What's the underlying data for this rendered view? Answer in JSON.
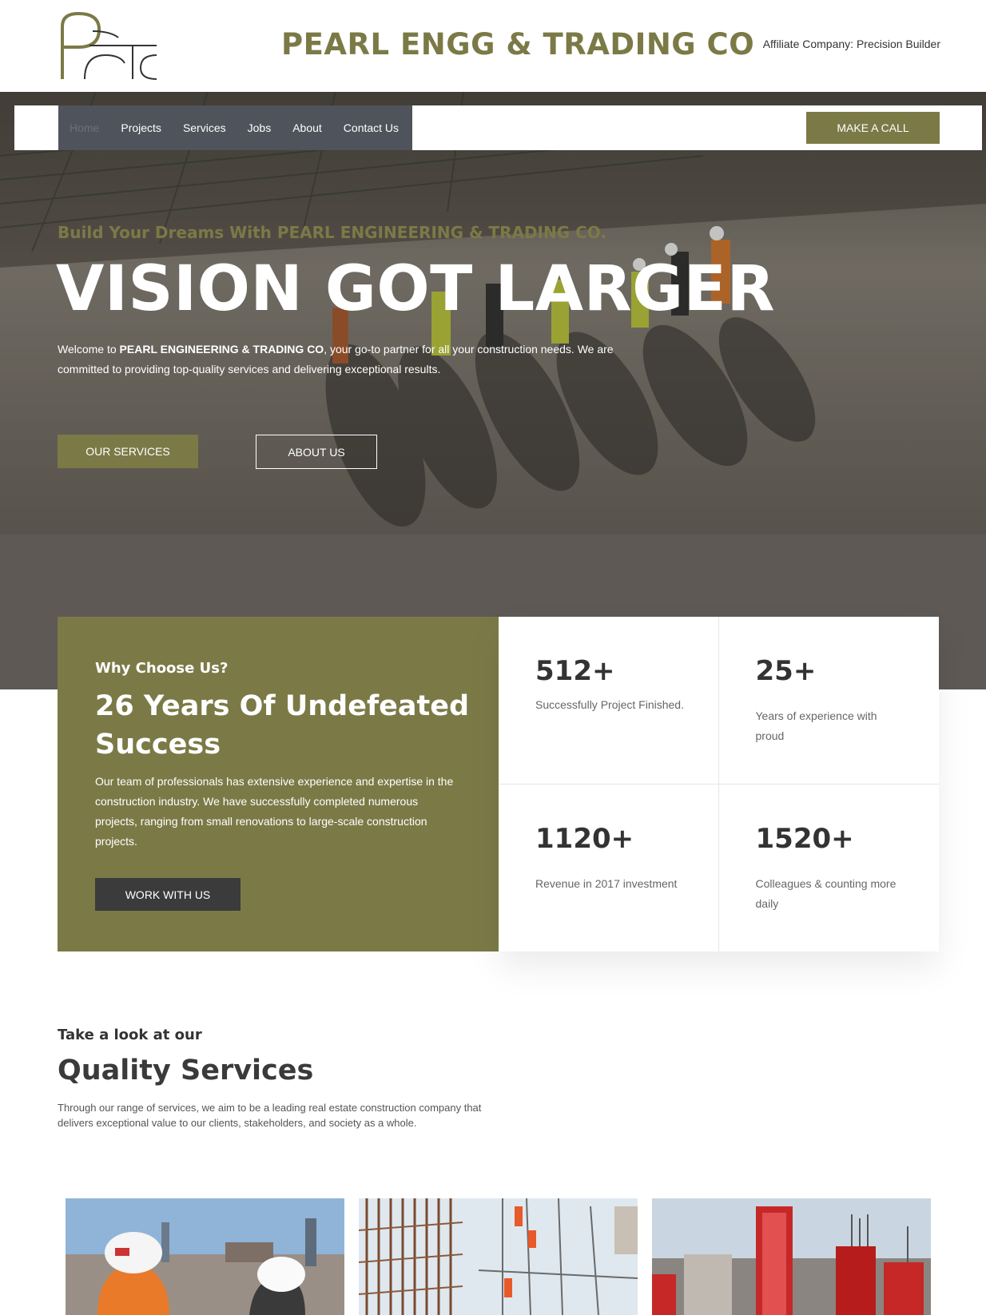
{
  "header": {
    "logo_alt": "PEtc",
    "site_title": "PEARL ENGG & TRADING CO",
    "affiliate": "Affiliate Company: Precision Builder"
  },
  "nav": {
    "items": [
      {
        "label": "Home",
        "active": true
      },
      {
        "label": "Projects"
      },
      {
        "label": "Services"
      },
      {
        "label": "Jobs"
      },
      {
        "label": "About"
      },
      {
        "label": "Contact Us"
      }
    ],
    "call_button": "MAKE A CALL"
  },
  "hero": {
    "subtitle": "Build Your Dreams With PEARL ENGINEERING & TRADING CO.",
    "title": "VISION GOT LARGER",
    "desc_prefix": "Welcome to ",
    "desc_company": "PEARL ENGINEERING & TRADING CO",
    "desc_suffix": ", your go-to partner for all your construction needs. We are committed to providing top-quality services and delivering exceptional results.",
    "btn_services": "OUR SERVICES",
    "btn_about": "ABOUT US"
  },
  "why": {
    "eyebrow": "Why Choose Us?",
    "title": "26 Years Of Undefeated Success",
    "text": "Our team of professionals has extensive experience and expertise in the construction industry. We have successfully completed numerous projects, ranging from small renovations to large-scale construction projects.",
    "button": "WORK WITH US"
  },
  "stats": [
    {
      "value": "512+",
      "label": "Successfully Project Finished."
    },
    {
      "value": "25+",
      "label": "Years of experience with proud"
    },
    {
      "value": "1120+",
      "label": "Revenue in 2017 investment"
    },
    {
      "value": "1520+",
      "label": "Colleagues & counting more daily"
    }
  ],
  "services": {
    "eyebrow": "Take a look at our",
    "title": "Quality Services",
    "text": "Through our range of services, we aim to be a leading real estate construction company that delivers exceptional value to our clients, stakeholders, and society as a whole."
  },
  "colors": {
    "brand": "#7b7a47",
    "nav_bg": "#4f535b",
    "dark_band": "#5e5955",
    "button_dark": "#3b3b3b"
  }
}
